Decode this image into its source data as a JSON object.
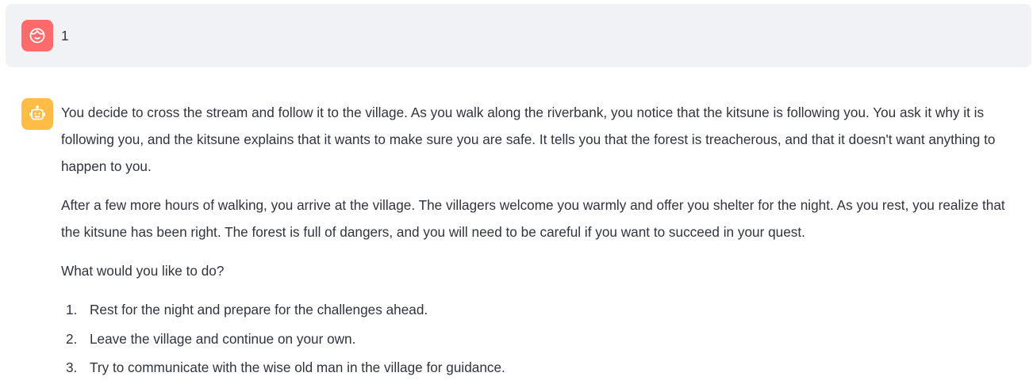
{
  "colors": {
    "user_avatar_bg": "#ff6b6b",
    "assistant_avatar_bg": "#ffbd45",
    "user_message_bg": "#f0f2f6",
    "text": "#31333f"
  },
  "messages": [
    {
      "role": "user",
      "avatar_icon": "smiley-face-icon",
      "text": "1"
    },
    {
      "role": "assistant",
      "avatar_icon": "robot-icon",
      "paragraphs": [
        "You decide to cross the stream and follow it to the village. As you walk along the riverbank, you notice that the kitsune is following you. You ask it why it is following you, and the kitsune explains that it wants to make sure you are safe. It tells you that the forest is treacherous, and that it doesn't want anything to happen to you.",
        "After a few more hours of walking, you arrive at the village. The villagers welcome you warmly and offer you shelter for the night. As you rest, you realize that the kitsune has been right. The forest is full of dangers, and you will need to be careful if you want to succeed in your quest.",
        "What would you like to do?"
      ],
      "options": [
        {
          "number": "1.",
          "text": "Rest for the night and prepare for the challenges ahead."
        },
        {
          "number": "2.",
          "text": "Leave the village and continue on your own."
        },
        {
          "number": "3.",
          "text": "Try to communicate with the wise old man in the village for guidance."
        }
      ]
    }
  ]
}
